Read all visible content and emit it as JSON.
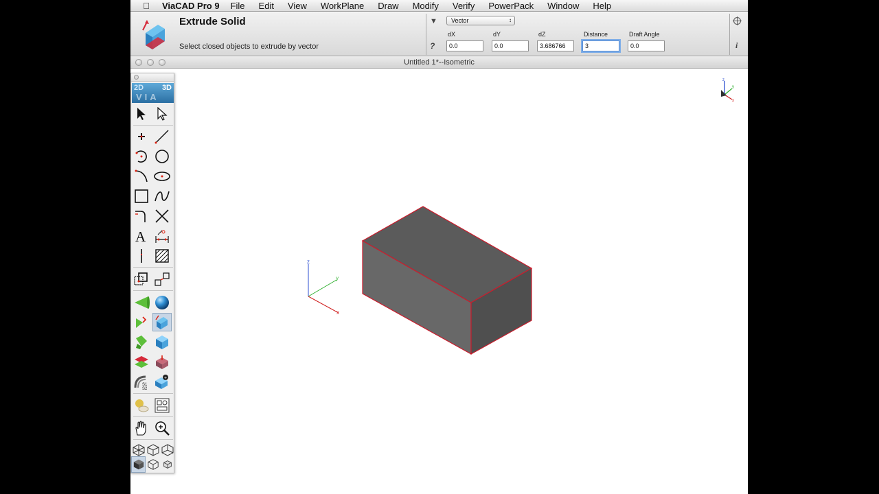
{
  "menubar": {
    "app_name": "ViaCAD Pro 9",
    "items": [
      "File",
      "Edit",
      "View",
      "WorkPlane",
      "Draw",
      "Modify",
      "Verify",
      "PowerPack",
      "Window",
      "Help"
    ]
  },
  "toolbar": {
    "tool_name": "Extrude Solid",
    "prompt": "Select closed objects to extrude by vector",
    "mode": "Vector",
    "fields": [
      {
        "label": "dX",
        "value": "0.0"
      },
      {
        "label": "dY",
        "value": "0.0"
      },
      {
        "label": "dZ",
        "value": "3.686766"
      },
      {
        "label": "Distance",
        "value": "3"
      },
      {
        "label": "Draft Angle",
        "value": "0.0"
      }
    ],
    "help_glyph": "?",
    "info_glyph": "i",
    "dropdown_glyph": "▼"
  },
  "window": {
    "title": "Untitled 1*--Isometric"
  },
  "palette": {
    "mode_2d": "2D",
    "mode_3d": "3D",
    "via": "VIA",
    "icons": [
      "select-arrow-icon",
      "select-hollow-arrow-icon",
      "point-icon",
      "line-icon",
      "arc-icon",
      "circle-icon",
      "curve-arc-icon",
      "ellipse-icon",
      "rectangle-icon",
      "spline-icon",
      "fillet-icon",
      "trim-icon",
      "text-icon",
      "dimension-icon",
      "centerline-icon",
      "hatch-icon",
      "snap-grid-icon",
      "transform-icon",
      "cone-icon",
      "sphere-icon",
      "revolve-icon",
      "extrude-icon",
      "loft-icon",
      "box-icon",
      "split-icon",
      "boolean-icon",
      "section-icon",
      "solid-edit-icon",
      "render-icon",
      "layers-icon",
      "pan-hand-icon",
      "zoom-icon",
      "view-iso-1-icon",
      "view-iso-2-icon",
      "view-iso-3-icon",
      "shaded-view-icon",
      "wireframe-view-icon",
      "hidden-line-view-icon"
    ]
  },
  "axes": {
    "x": "x",
    "y": "y",
    "z": "z"
  },
  "colors": {
    "solid_top": "#5a5a5a",
    "solid_front": "#6a6a6a",
    "solid_side": "#4e4e4e",
    "edge": "#cc1c2c",
    "axis_x": "#d02020",
    "axis_y": "#30b030",
    "axis_z": "#2c4fd0",
    "palette_accent": "#3b86c0"
  }
}
